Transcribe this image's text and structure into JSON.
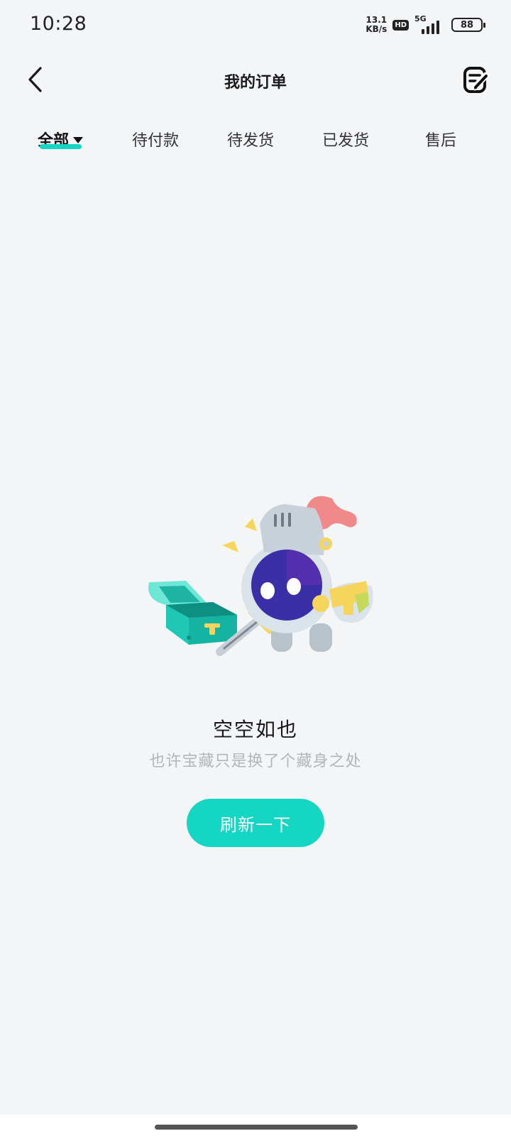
{
  "status_bar": {
    "time": "10:28",
    "net_speed_value": "13.1",
    "net_speed_unit": "KB/s",
    "hd_badge": "HD",
    "network": "5G",
    "battery": "88"
  },
  "header": {
    "title": "我的订单",
    "back_icon": "chevron-left-icon",
    "edit_icon": "edit-note-icon"
  },
  "tabs": [
    {
      "label": "全部",
      "active": true
    },
    {
      "label": "待付款",
      "active": false
    },
    {
      "label": "待发货",
      "active": false
    },
    {
      "label": "已发货",
      "active": false
    },
    {
      "label": "售后",
      "active": false
    }
  ],
  "empty_state": {
    "illustration": "knight-treasure-illustration",
    "title": "空空如也",
    "subtitle": "也许宝藏只是换了个藏身之处",
    "button_label": "刷新一下"
  },
  "colors": {
    "accent": "#14d6c2",
    "background": "#f3f5f7",
    "subtitle": "#b2b5ba"
  }
}
